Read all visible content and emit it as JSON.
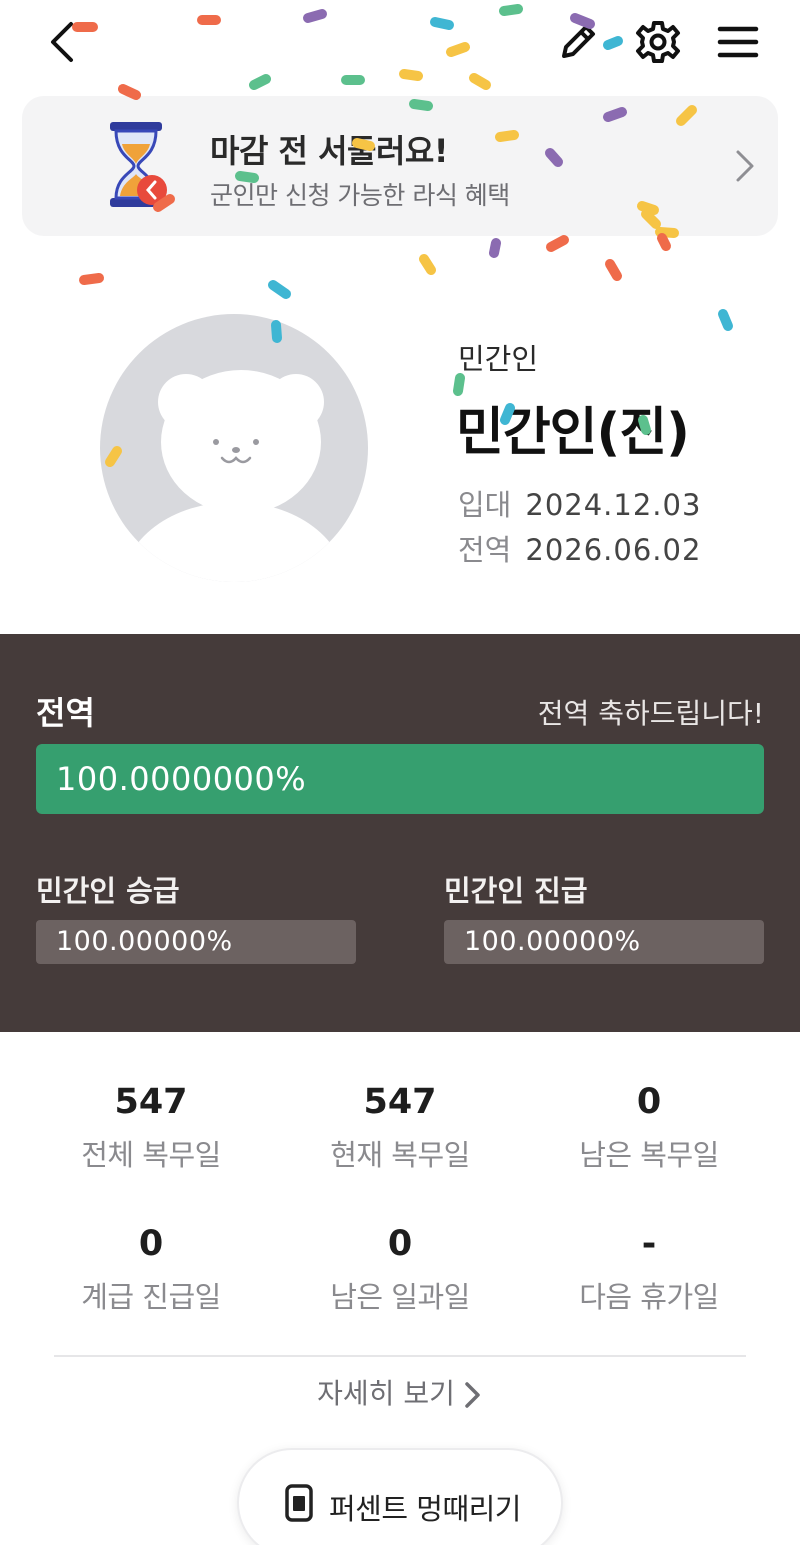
{
  "topbar": {
    "back_icon": "chevron-left-icon",
    "edit_icon": "pencil-icon",
    "settings_icon": "gear-icon",
    "menu_icon": "hamburger-icon"
  },
  "banner": {
    "title": "마감 전 서둘러요!",
    "subtitle": "군인만 신청 가능한 라식 혜택",
    "icon": "hourglass-icon"
  },
  "profile": {
    "subtitle": "민간인",
    "name": "민간인(진)",
    "enlist_label": "입대",
    "enlist_date": "2024.12.03",
    "discharge_label": "전역",
    "discharge_date": "2026.06.02",
    "avatar_icon": "bear-avatar-icon"
  },
  "progress": {
    "title": "전역",
    "message": "전역 축하드립니다!",
    "main_text": "100.0000000%",
    "main_fraction": 1.0,
    "promotion_label": "민간인 승급",
    "promotion_text": "100.00000%",
    "promotion_fraction": 1.0,
    "advance_label": "민간인 진급",
    "advance_text": "100.00000%",
    "advance_fraction": 1.0
  },
  "stats": [
    {
      "value": "547",
      "label": "전체 복무일"
    },
    {
      "value": "547",
      "label": "현재 복무일"
    },
    {
      "value": "0",
      "label": "남은 복무일"
    },
    {
      "value": "0",
      "label": "계급 진급일"
    },
    {
      "value": "0",
      "label": "남은 일과일"
    },
    {
      "value": "-",
      "label": "다음 휴가일"
    }
  ],
  "more_label": "자세히 보기",
  "pill": {
    "label": "퍼센트 멍때리기",
    "icon": "phone-icon"
  },
  "colors": {
    "panel_bg": "#453b3a",
    "progress_green": "#369f6f",
    "banner_bg": "#f4f4f5",
    "confetti": [
      "#ef6b4a",
      "#f6c445",
      "#5cc08d",
      "#3fb6d3",
      "#8b6bb1"
    ]
  }
}
